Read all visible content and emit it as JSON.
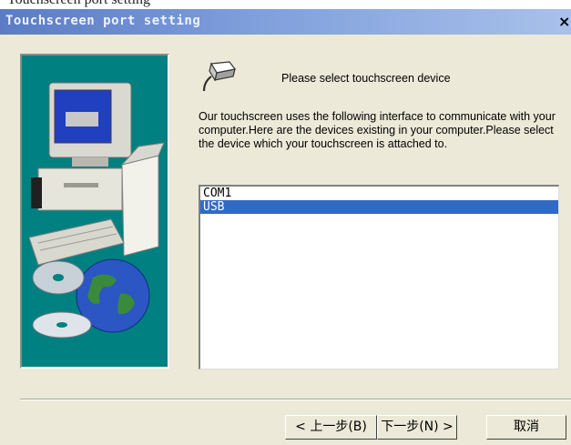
{
  "window": {
    "top_cropped_text": "Touchscreen port setting",
    "title": "Touchscreen port setting",
    "close_glyph": "×"
  },
  "header": {
    "icon": "usb-connector-icon",
    "heading": "Please select touchscreen device"
  },
  "description": "Our touchscreen uses the following interface to communicate with your computer.Here are the devices existing in your computer.Please select the device which your touchscreen is attached to.",
  "device_list": {
    "items": [
      "COM1",
      "USB"
    ],
    "selected": "USB"
  },
  "buttons": {
    "back": "< 上一步(B)",
    "next": "下一步(N) >",
    "cancel": "取消"
  },
  "colors": {
    "title_gradient_start": "#5b7bc4",
    "title_gradient_end": "#a9c1ea",
    "banner_background": "#008080",
    "selection": "#316ac5",
    "dialog_background": "#ece9d8"
  }
}
